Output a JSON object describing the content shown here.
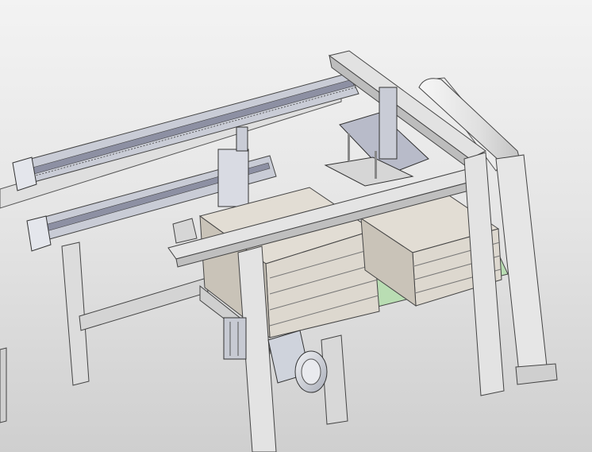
{
  "viewport": {
    "background_top": "#f3f3f3",
    "background_bottom": "#cfcfcf"
  },
  "colors": {
    "frame": "#e3e3e3",
    "frame_dark": "#b9b9b9",
    "actuator": "#c9ccd6",
    "actuator_dark": "#8d90a3",
    "crate": "#ddd8cf",
    "crate_dark": "#bdb6ac",
    "belt": "#b9ddb3",
    "motor": "#cfd3dc"
  }
}
